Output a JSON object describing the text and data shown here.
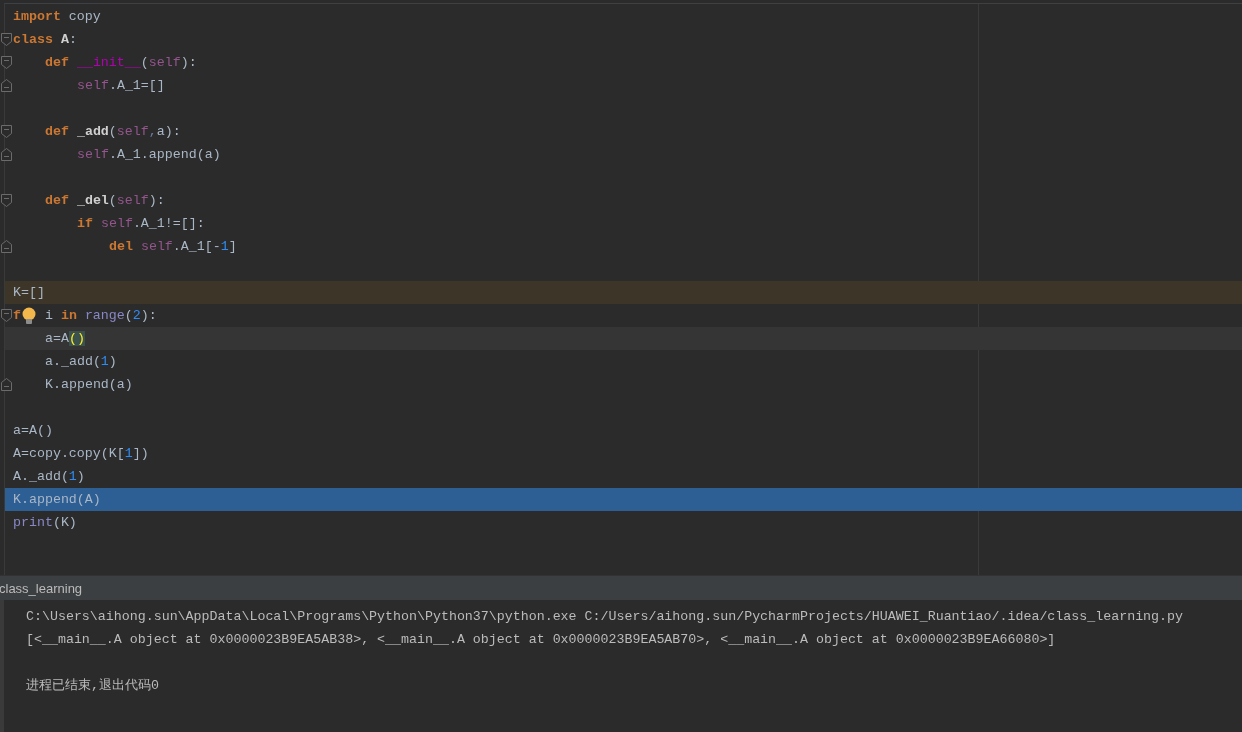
{
  "editor": {
    "lines": [
      {
        "kind": "plain",
        "tokens": [
          {
            "t": "import",
            "kind": "kw"
          },
          {
            "t": " copy",
            "kind": "name"
          }
        ]
      },
      {
        "kind": "plain",
        "foldable": true,
        "tokens": [
          {
            "t": "class",
            "kind": "kw"
          },
          {
            "t": " A",
            "kind": "defname"
          },
          {
            "t": ":",
            "kind": "name"
          }
        ],
        "children": [
          {
            "kind": "plain",
            "foldable": true,
            "tokens": [
              {
                "t": "def",
                "kind": "kw"
              },
              {
                "t": " __init__",
                "kind": "magic"
              },
              {
                "t": "(",
                "kind": "name"
              },
              {
                "t": "self",
                "kind": "self"
              },
              {
                "t": "):",
                "kind": "name"
              }
            ],
            "children": [
              {
                "kind": "plain",
                "fold_end": true,
                "tokens": [
                  {
                    "t": "self",
                    "kind": "self"
                  },
                  {
                    "t": ".A_1=[]",
                    "kind": "name"
                  }
                ]
              }
            ]
          },
          {
            "kind": "plain"
          },
          {
            "kind": "plain",
            "foldable": true,
            "tokens": [
              {
                "t": "def",
                "kind": "kw"
              },
              {
                "t": " _add",
                "kind": "defname"
              },
              {
                "t": "(",
                "kind": "name"
              },
              {
                "t": "self",
                "kind": "self"
              },
              {
                "t": ",",
                "kind": "comma"
              },
              {
                "t": "a):",
                "kind": "name"
              }
            ],
            "children": [
              {
                "kind": "plain",
                "fold_end": true,
                "tokens": [
                  {
                    "t": "self",
                    "kind": "self"
                  },
                  {
                    "t": ".A_1.append(a)",
                    "kind": "name"
                  }
                ]
              }
            ]
          },
          {
            "kind": "plain"
          },
          {
            "kind": "plain",
            "foldable": true,
            "tokens": [
              {
                "t": "def",
                "kind": "kw"
              },
              {
                "t": " _del",
                "kind": "defname"
              },
              {
                "t": "(",
                "kind": "name"
              },
              {
                "t": "self",
                "kind": "self"
              },
              {
                "t": "):",
                "kind": "name"
              }
            ],
            "children": [
              {
                "kind": "plain",
                "tokens": [
                  {
                    "t": "if",
                    "kind": "kw"
                  },
                  {
                    "t": " self",
                    "kind": "self"
                  },
                  {
                    "t": ".A_1!=[]:",
                    "kind": "name"
                  }
                ],
                "children": [
                  {
                    "kind": "plain",
                    "fold_end": true,
                    "tokens": [
                      {
                        "t": "del",
                        "kind": "kw"
                      },
                      {
                        "t": " self",
                        "kind": "self"
                      },
                      {
                        "t": ".A_1[-",
                        "kind": "name"
                      },
                      {
                        "t": "1",
                        "kind": "num"
                      },
                      {
                        "t": "]",
                        "kind": "name"
                      }
                    ]
                  }
                ]
              }
            ]
          }
        ]
      },
      {
        "kind": "plain"
      },
      {
        "kind": "flagged",
        "tokens": [
          {
            "t": "K=[]",
            "kind": "name"
          }
        ]
      },
      {
        "kind": "plain",
        "foldable": true,
        "tokens": [
          {
            "t": "f",
            "kind": "kw"
          },
          {
            "kind": "bulb"
          },
          {
            "t": " i ",
            "kind": "name"
          },
          {
            "t": "in",
            "kind": "kw"
          },
          {
            "t": " range",
            "kind": "builtin"
          },
          {
            "t": "(",
            "kind": "name"
          },
          {
            "t": "2",
            "kind": "num"
          },
          {
            "t": "):",
            "kind": "name"
          }
        ],
        "children": [
          {
            "kind": "current",
            "tokens": [
              {
                "t": "a=A",
                "kind": "name"
              },
              {
                "t": "()",
                "kind": "match"
              }
            ]
          },
          {
            "kind": "plain",
            "tokens": [
              {
                "t": "a._add(",
                "kind": "name"
              },
              {
                "t": "1",
                "kind": "num"
              },
              {
                "t": ")",
                "kind": "name"
              }
            ]
          },
          {
            "kind": "plain",
            "fold_end": true,
            "tokens": [
              {
                "t": "K.append(a)",
                "kind": "name"
              }
            ]
          }
        ]
      },
      {
        "kind": "plain"
      },
      {
        "kind": "plain",
        "tokens": [
          {
            "t": "a=A()",
            "kind": "name"
          }
        ]
      },
      {
        "kind": "plain",
        "tokens": [
          {
            "t": "A=copy.copy(K[",
            "kind": "name"
          },
          {
            "t": "1",
            "kind": "num"
          },
          {
            "t": "])",
            "kind": "name"
          }
        ]
      },
      {
        "kind": "plain",
        "tokens": [
          {
            "t": "A._add(",
            "kind": "name"
          },
          {
            "t": "1",
            "kind": "num"
          },
          {
            "t": ")",
            "kind": "name"
          }
        ]
      },
      {
        "kind": "selected",
        "tokens": [
          {
            "t": "K.append(A)",
            "kind": "name"
          }
        ]
      },
      {
        "kind": "plain",
        "tokens": [
          {
            "t": "print",
            "kind": "builtin"
          },
          {
            "t": "(K)",
            "kind": "name"
          }
        ]
      }
    ]
  },
  "run_panel": {
    "tab": "class_learning",
    "output": [
      "C:\\Users\\aihong.sun\\AppData\\Local\\Programs\\Python\\Python37\\python.exe C:/Users/aihong.sun/PycharmProjects/HUAWEI_Ruantiao/.idea/class_learning.py",
      "[<__main__.A object at 0x0000023B9EA5AB38>, <__main__.A object at 0x0000023B9EA5AB70>, <__main__.A object at 0x0000023B9EA66080>]",
      "进程已结束,退出代码0"
    ]
  }
}
